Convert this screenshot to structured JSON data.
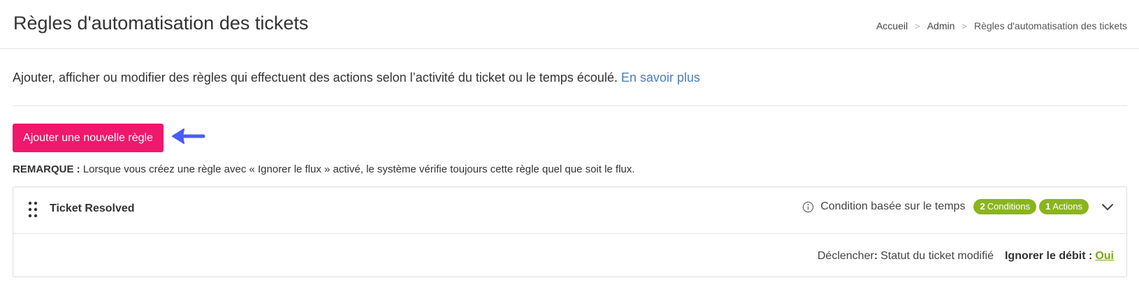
{
  "header": {
    "title": "Règles d'automatisation des tickets",
    "breadcrumb": {
      "home": "Accueil",
      "separator": ">",
      "admin": "Admin",
      "current": "Règles d'automatisation des tickets"
    }
  },
  "intro": {
    "description": "Ajouter, afficher ou modifier des règles qui effectuent des actions selon l’activité du ticket ou le temps écoulé.",
    "learn_more": "En savoir plus"
  },
  "add_rule_button": "Ajouter une nouvelle règle",
  "note": {
    "label": "REMARQUE :",
    "text": "Lorsque vous créez une règle avec « Ignorer le flux » activé, le système vérifie toujours cette règle quel que soit le flux."
  },
  "rule": {
    "name": "Ticket Resolved",
    "condition_type": "Condition basée sur le temps",
    "conditions_count": "2",
    "conditions_label": "Conditions",
    "actions_count": "1",
    "actions_label": "Actions",
    "trigger_label": "Déclencher",
    "trigger_colon": ":",
    "trigger_value": "Statut du ticket modifié",
    "skip_label": "Ignorer le débit :",
    "skip_value": "Oui"
  },
  "colors": {
    "primary_button": "#f0186c",
    "badge": "#8ab51e",
    "link": "#4a7fb5",
    "annotation_arrow": "#4a5df5"
  },
  "icons": [
    "drag-handle-icon",
    "info-icon",
    "chevron-down-icon",
    "arrow-left-icon"
  ]
}
